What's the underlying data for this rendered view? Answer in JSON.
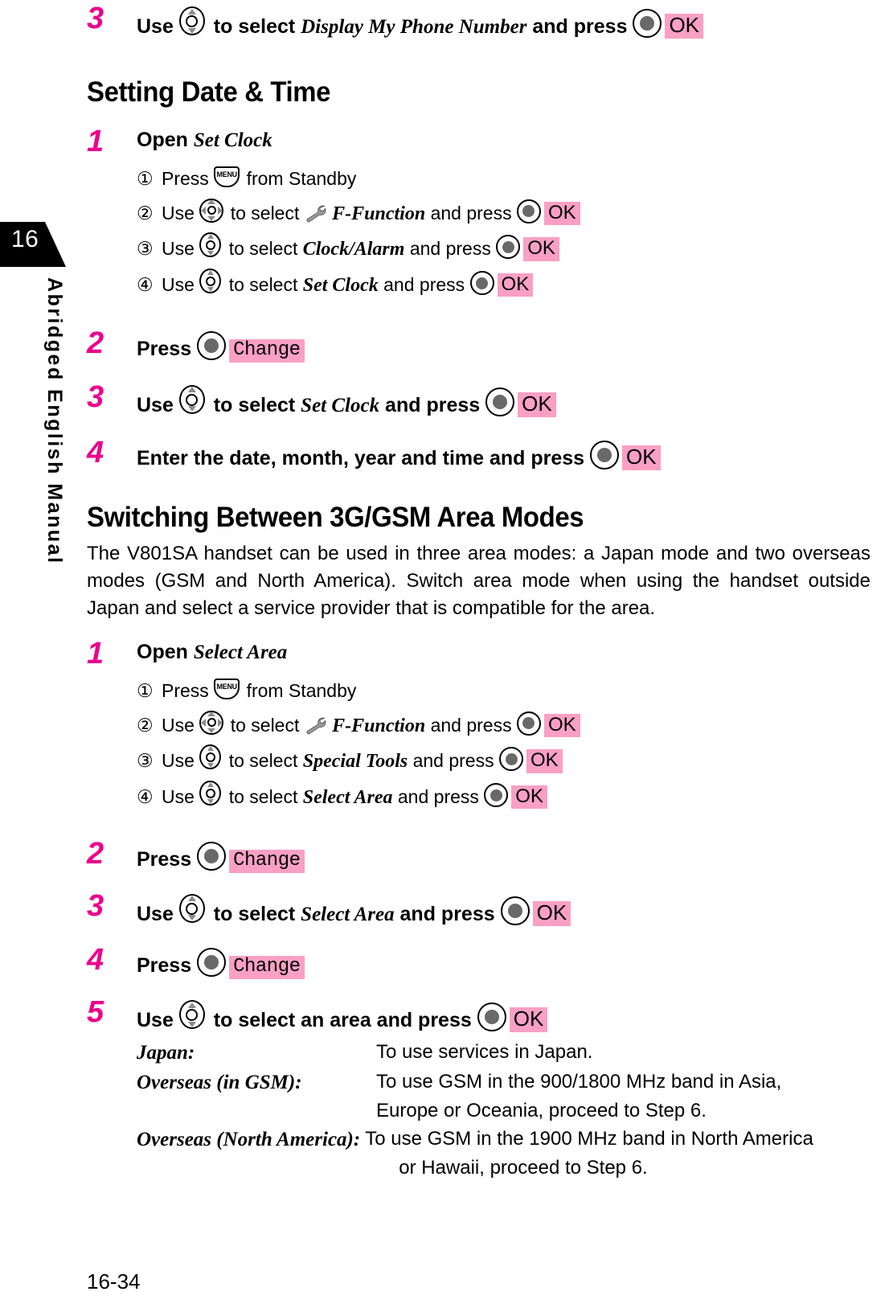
{
  "sidebar": {
    "chapter_number": "16",
    "vertical_label": "Abridged English Manual"
  },
  "footer": {
    "page_number": "16-34"
  },
  "colors": {
    "step_number": "#EC008C",
    "softkey_badge": "#F9A0C4",
    "tab_background": "#000000",
    "key_triangle": "#8A8A8A",
    "key_center_dot": "#696969"
  },
  "icons": {
    "nav_up_down": "nav-up-down-key-icon",
    "nav_four_way": "nav-four-way-key-icon",
    "center_select": "center-select-key-icon",
    "menu_key": "menu-key-icon",
    "menu_key_label": "MENU",
    "wrench": "wrench-icon"
  },
  "top_step": {
    "number": "3",
    "text_before": "Use",
    "text_middle": "to select",
    "target": "Display My Phone Number",
    "text_after": "and press",
    "badge": "OK"
  },
  "sections": [
    {
      "title": "Setting Date & Time",
      "steps": [
        {
          "number": "1",
          "label": "Open",
          "target": "Set Clock",
          "substeps": [
            {
              "marker": "①",
              "verb": "Press",
              "key": "menu",
              "tail": "from Standby"
            },
            {
              "marker": "②",
              "verb": "Use",
              "key": "four-way",
              "mid": "to select",
              "wrench": true,
              "target": "F-Function",
              "after": "and press",
              "badge": "OK"
            },
            {
              "marker": "③",
              "verb": "Use",
              "key": "up-down",
              "mid": "to select",
              "wrench": false,
              "target": "Clock/Alarm",
              "after": "and press",
              "badge": "OK"
            },
            {
              "marker": "④",
              "verb": "Use",
              "key": "up-down",
              "mid": "to select",
              "wrench": false,
              "target": "Set Clock",
              "after": "and press",
              "badge": "OK"
            }
          ]
        },
        {
          "number": "2",
          "kind": "press",
          "label": "Press",
          "badge": "Change"
        },
        {
          "number": "3",
          "kind": "use",
          "label": "Use",
          "mid": "to select",
          "target": "Set Clock",
          "after": "and press",
          "badge": "OK"
        },
        {
          "number": "4",
          "kind": "plain",
          "label": "Enter the date, month, year and time and press",
          "badge": "OK"
        }
      ]
    },
    {
      "title": "Switching Between 3G/GSM Area Modes",
      "intro": "The V801SA handset can be used in three area modes: a Japan mode and two overseas modes (GSM and North America). Switch area mode when using the handset outside Japan and select a service provider that is compatible for the area.",
      "steps": [
        {
          "number": "1",
          "label": "Open",
          "target": "Select Area",
          "substeps": [
            {
              "marker": "①",
              "verb": "Press",
              "key": "menu",
              "tail": "from Standby"
            },
            {
              "marker": "②",
              "verb": "Use",
              "key": "four-way",
              "mid": "to select",
              "wrench": true,
              "target": "F-Function",
              "after": "and press",
              "badge": "OK"
            },
            {
              "marker": "③",
              "verb": "Use",
              "key": "up-down",
              "mid": "to select",
              "wrench": false,
              "target": "Special Tools",
              "after": "and press",
              "badge": "OK"
            },
            {
              "marker": "④",
              "verb": "Use",
              "key": "up-down",
              "mid": "to select",
              "wrench": false,
              "target": "Select Area",
              "after": "and press",
              "badge": "OK"
            }
          ]
        },
        {
          "number": "2",
          "kind": "press",
          "label": "Press",
          "badge": "Change"
        },
        {
          "number": "3",
          "kind": "use",
          "label": "Use",
          "mid": "to select",
          "target": "Select Area",
          "after": "and press",
          "badge": "OK"
        },
        {
          "number": "4",
          "kind": "press",
          "label": "Press",
          "badge": "Change"
        },
        {
          "number": "5",
          "kind": "use-plain",
          "label": "Use",
          "mid": "to select an area and press",
          "badge": "OK"
        }
      ],
      "area_options": [
        {
          "term": "Japan:",
          "desc": "To use services in Japan.",
          "desc_cont": ""
        },
        {
          "term": "Overseas (in GSM):",
          "desc": "To use GSM in the 900/1800 MHz band in Asia,",
          "desc_cont": "Europe or Oceania, proceed to Step 6."
        },
        {
          "term": "Overseas (North America):",
          "desc": "To use GSM in the 1900 MHz band in North America",
          "desc_cont": "or Hawaii, proceed to Step 6."
        }
      ]
    }
  ]
}
